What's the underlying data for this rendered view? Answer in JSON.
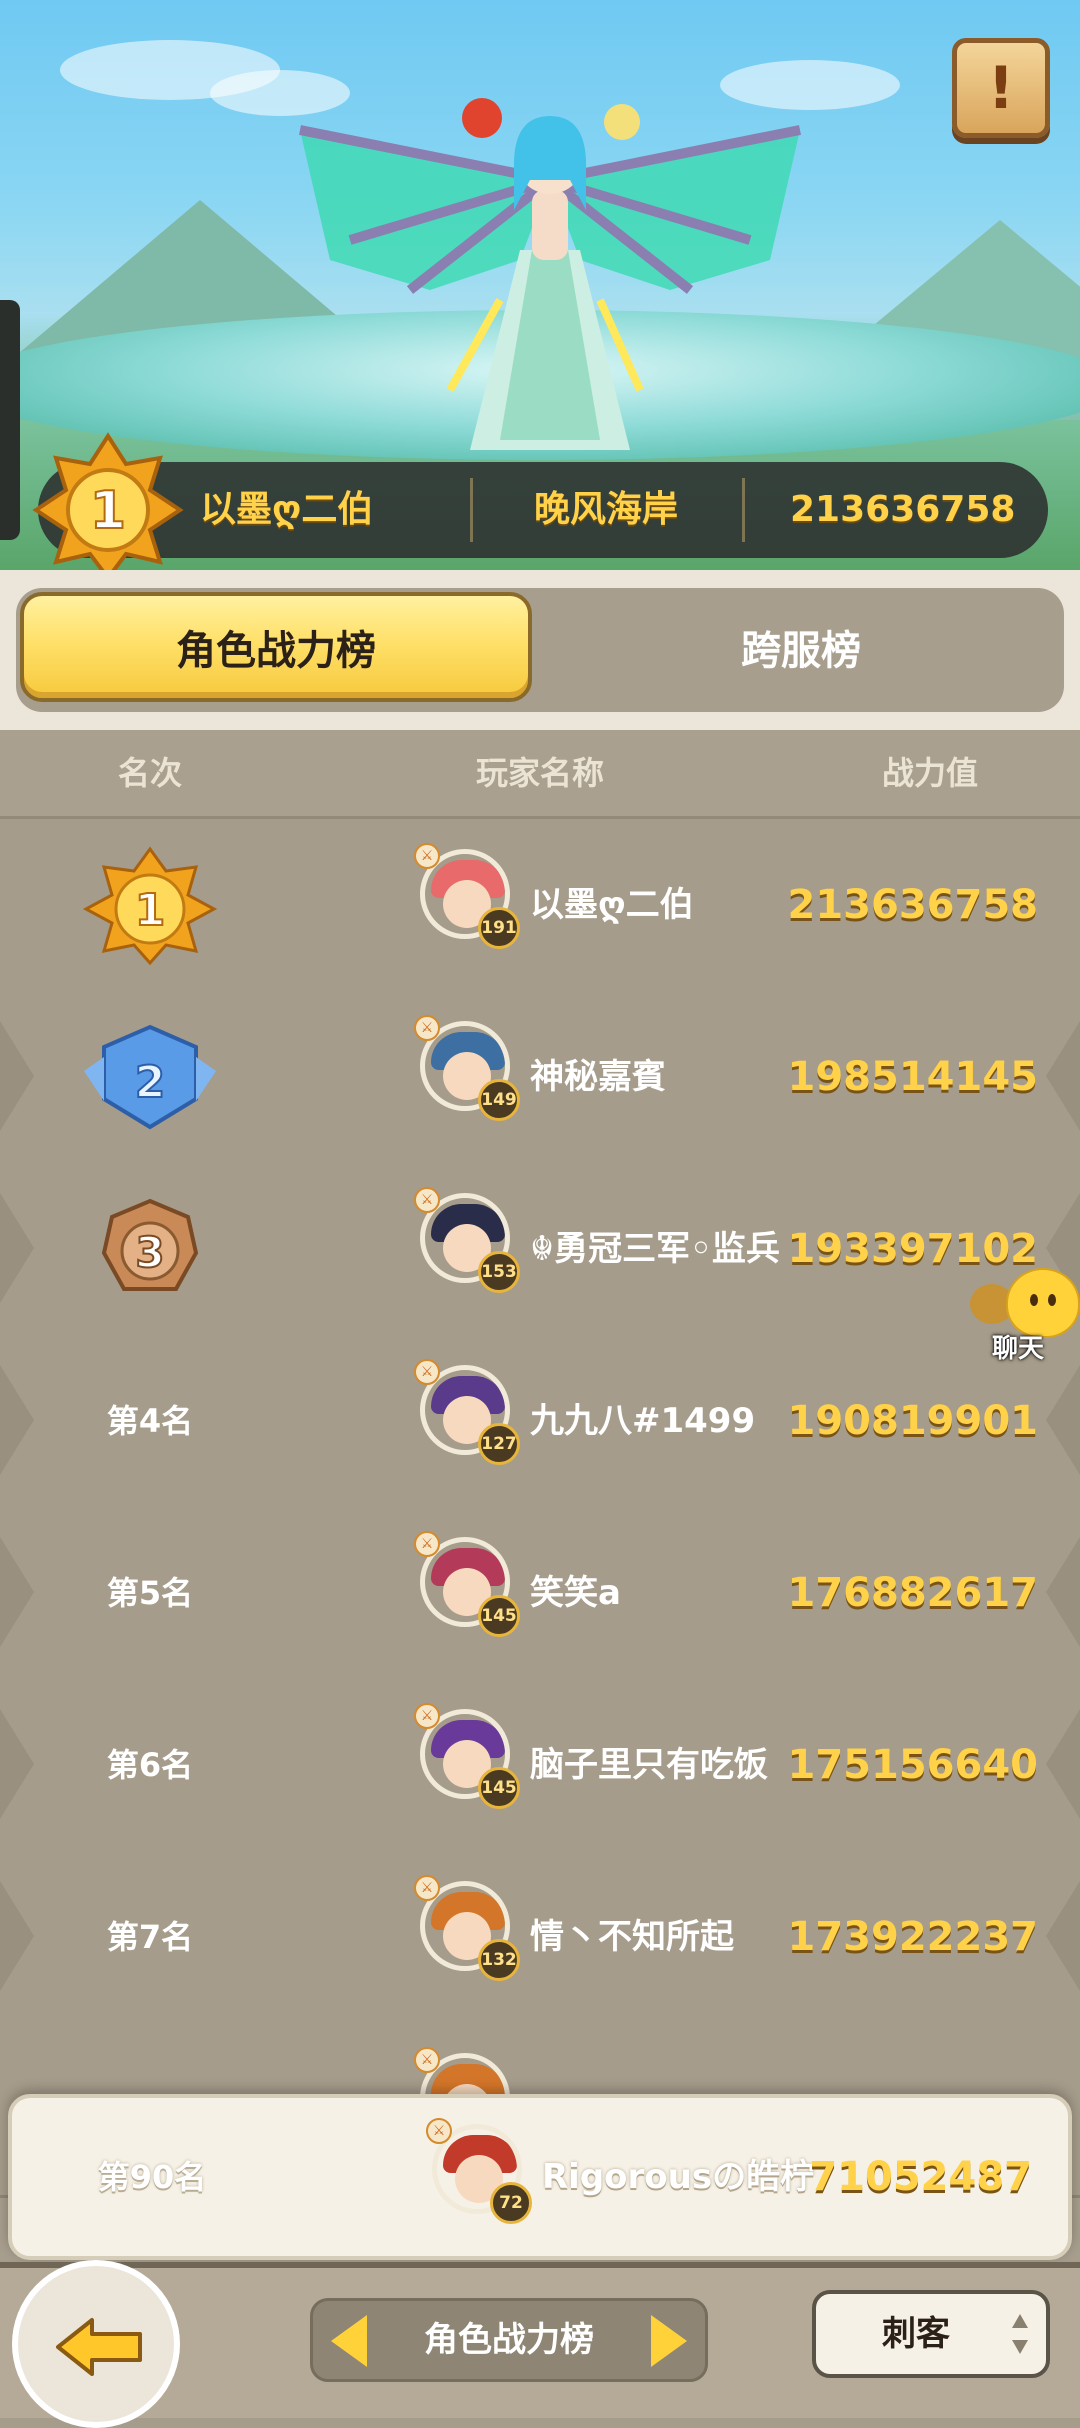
{
  "hero": {
    "top_player": {
      "rank": "1",
      "name": "以墨ღ二伯",
      "server": "晚风海岸",
      "power": "213636758"
    },
    "info_button": "!"
  },
  "tabs": [
    {
      "label": "角色战力榜",
      "active": true
    },
    {
      "label": "跨服榜",
      "active": false
    }
  ],
  "table": {
    "headers": {
      "rank": "名次",
      "player": "玩家名称",
      "power": "战力值"
    },
    "rows": [
      {
        "rank": "1",
        "rank_text": "",
        "name": "以墨ღ二伯",
        "level": "191",
        "power": "213636758",
        "avatar_color": "#e86a6a"
      },
      {
        "rank": "2",
        "rank_text": "",
        "name": "神秘嘉賓",
        "level": "149",
        "power": "198514145",
        "avatar_color": "#3d6fa3"
      },
      {
        "rank": "3",
        "rank_text": "",
        "name": "☬勇冠三军◦监兵",
        "level": "153",
        "power": "193397102",
        "avatar_color": "#2a2d4a"
      },
      {
        "rank": "4",
        "rank_text": "第4名",
        "name": "九九八#1499",
        "level": "127",
        "power": "190819901",
        "avatar_color": "#5a3a8a"
      },
      {
        "rank": "5",
        "rank_text": "第5名",
        "name": "笑笑a",
        "level": "145",
        "power": "176882617",
        "avatar_color": "#b43a5a"
      },
      {
        "rank": "6",
        "rank_text": "第6名",
        "name": "脑子里只有吃饭",
        "level": "145",
        "power": "175156640",
        "avatar_color": "#6a3a9a"
      },
      {
        "rank": "7",
        "rank_text": "第7名",
        "name": "情丶不知所起",
        "level": "132",
        "power": "173922237",
        "avatar_color": "#d4762a"
      }
    ]
  },
  "chat": {
    "label": "聊天"
  },
  "my_rank": {
    "rank_text": "第90名",
    "name": "Rigorousの皓柠",
    "level": "72",
    "power": "71052487"
  },
  "bottom": {
    "switcher_label": "角色战力榜",
    "class_select": "刺客"
  },
  "colors": {
    "gold": "#ffd24a",
    "tab_active": "#ffe069",
    "row_bg": "#a69c8b"
  }
}
